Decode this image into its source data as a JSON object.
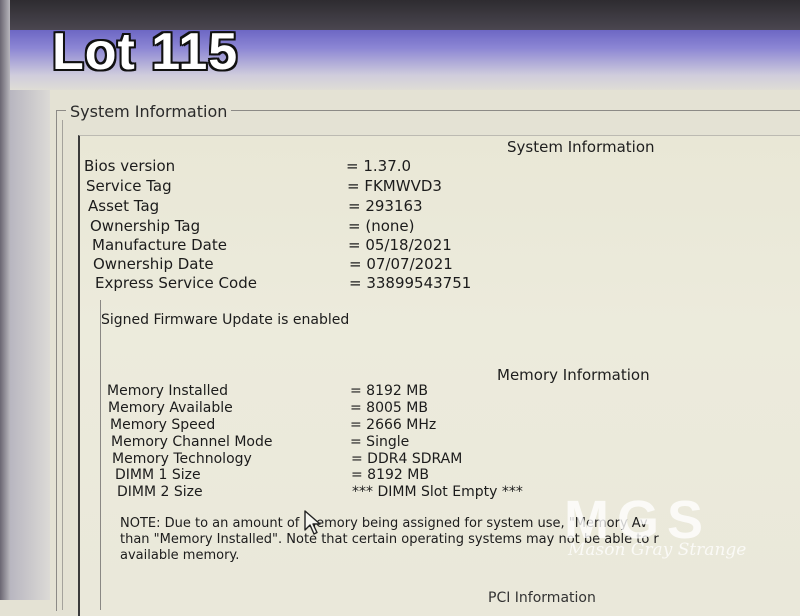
{
  "overlay": {
    "lot_label": "Lot 115"
  },
  "group": {
    "title": "System Information"
  },
  "system": {
    "heading": "System Information",
    "rows": [
      {
        "label": "Bios version",
        "value": "= 1.37.0"
      },
      {
        "label": "Service Tag",
        "value": "= FKMWVD3"
      },
      {
        "label": "Asset Tag",
        "value": "= 293163"
      },
      {
        "label": "Ownership Tag",
        "value": "= (none)"
      },
      {
        "label": "Manufacture Date",
        "value": "= 05/18/2021"
      },
      {
        "label": "Ownership Date",
        "value": "= 07/07/2021"
      },
      {
        "label": "Express Service Code",
        "value": "= 33899543751"
      }
    ],
    "signed_firmware": "Signed Firmware Update is enabled"
  },
  "memory": {
    "heading": "Memory Information",
    "rows": [
      {
        "label": "Memory Installed",
        "value": "= 8192 MB"
      },
      {
        "label": "Memory Available",
        "value": "= 8005 MB"
      },
      {
        "label": "Memory Speed",
        "value": "= 2666 MHz"
      },
      {
        "label": "Memory Channel Mode",
        "value": "= Single"
      },
      {
        "label": "Memory Technology",
        "value": "= DDR4 SDRAM"
      },
      {
        "label": "DIMM 1 Size",
        "value": "= 8192 MB"
      },
      {
        "label": "DIMM 2 Size",
        "value": "*** DIMM Slot Empty ***"
      }
    ],
    "note_lines": [
      "NOTE: Due to an amount of memory being assigned for system use, \"Memory Av",
      "than \"Memory Installed\". Note that certain operating systems may not be able to r",
      "available memory."
    ]
  },
  "pci_heading_partial": "PCI Information",
  "watermark": {
    "logo": "MGS",
    "text": "Mason Gray Strange"
  }
}
